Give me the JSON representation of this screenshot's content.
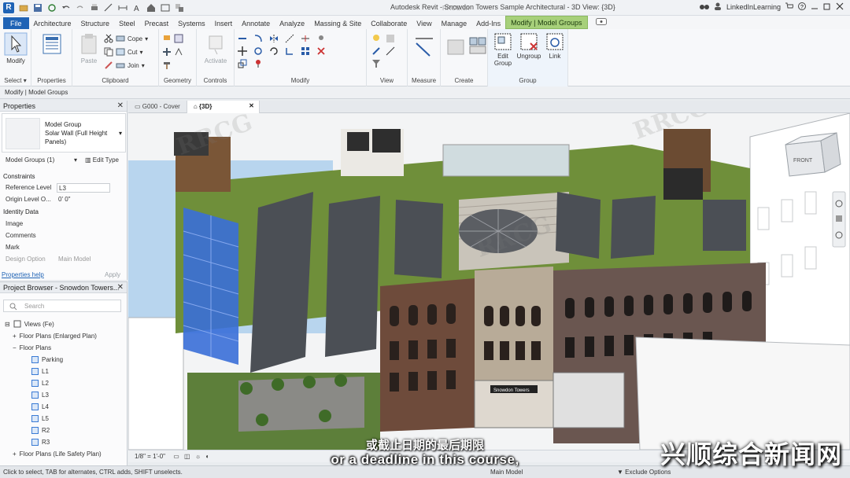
{
  "window": {
    "title": "Autodesk Revit - Snowdon Towers Sample Architectural - 3D View: {3D}",
    "user": "LinkedInLearning",
    "watermark_top": "RRCG.cn"
  },
  "ribbon_tabs": [
    "File",
    "Architecture",
    "Structure",
    "Steel",
    "Precast",
    "Systems",
    "Insert",
    "Annotate",
    "Analyze",
    "Massing & Site",
    "Collaborate",
    "View",
    "Manage",
    "Add-Ins",
    "Modify | Model Groups"
  ],
  "ribbon": {
    "select": {
      "modify_label": "Modify",
      "panel": "Select"
    },
    "properties": {
      "panel": "Properties",
      "button": "Properties"
    },
    "clipboard": {
      "panel": "Clipboard",
      "paste": "Paste",
      "cope": "Cope",
      "cut": "Cut",
      "join": "Join"
    },
    "geometry": {
      "panel": "Geometry"
    },
    "controls": {
      "panel": "Controls",
      "activate": "Activate"
    },
    "modify": {
      "panel": "Modify"
    },
    "view": {
      "panel": "View"
    },
    "measure": {
      "panel": "Measure"
    },
    "create": {
      "panel": "Create"
    },
    "group": {
      "panel": "Group",
      "edit_group": "Edit Group",
      "ungroup": "Ungroup",
      "link": "Link"
    }
  },
  "options_bar": {
    "text": "Modify | Model Groups"
  },
  "properties_palette": {
    "title": "Properties",
    "type_family": "Model Group",
    "type_name": "Solar Wall (Full Height Panels)",
    "selection_filter": "Model Groups (1)",
    "edit_type": "Edit Type",
    "sections": [
      {
        "label": "Constraints"
      },
      {
        "label": "Identity Data"
      }
    ],
    "rows": [
      {
        "name": "Reference Level",
        "value": "L3"
      },
      {
        "name": "Origin Level O...",
        "value": "0'  0\""
      },
      {
        "name": "Image",
        "value": ""
      },
      {
        "name": "Comments",
        "value": ""
      },
      {
        "name": "Mark",
        "value": ""
      },
      {
        "name": "Design Option",
        "value": "Main Model"
      }
    ],
    "help": "Properties help",
    "apply": "Apply"
  },
  "project_browser": {
    "title": "Project Browser - Snowdon Towers...",
    "search_placeholder": "Search",
    "items": [
      {
        "label": "Views (Fe)"
      },
      {
        "label": "Floor Plans (Enlarged Plan)"
      },
      {
        "label": "Floor Plans"
      },
      {
        "label": "Parking"
      },
      {
        "label": "L1"
      },
      {
        "label": "L2"
      },
      {
        "label": "L3"
      },
      {
        "label": "L4"
      },
      {
        "label": "L5"
      },
      {
        "label": "R2"
      },
      {
        "label": "R3"
      },
      {
        "label": "Floor Plans (Life Safety Plan)"
      }
    ]
  },
  "view_tabs": [
    {
      "label": "G000 - Cover"
    },
    {
      "label": "{3D}"
    }
  ],
  "viewport": {
    "view_cube_face": "FRONT",
    "building_sign": "Snowdon Towers"
  },
  "view_control_bar": {
    "scale": "1/8\" = 1'-0\""
  },
  "status_bar": {
    "hint": "Click to select, TAB for alternates, CTRL adds, SHIFT unselects.",
    "model": "Main Model",
    "exclude": "Exclude Options"
  },
  "overlay": {
    "subtitle_top": "或截止日期的最后期限",
    "subtitle": "or a deadline in this course,",
    "watermark_cn": "兴顺综合新闻网",
    "watermark_logo": "RRCG"
  },
  "colors": {
    "file_tab": "#1f63b5",
    "context_tab": "#a7d07a",
    "selection_blue": "#3a6fd8"
  }
}
